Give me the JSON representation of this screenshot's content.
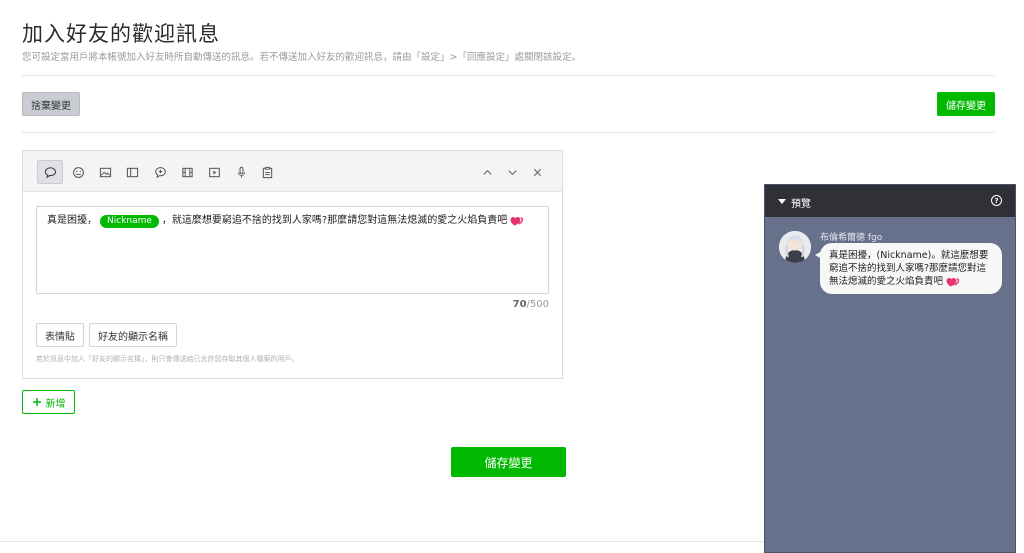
{
  "page": {
    "title": "加入好友的歡迎訊息",
    "description": "您可設定當用戶將本帳號加入好友時所自動傳送的訊息。若不傳送加入好友的歡迎訊息，請由「設定」>「回應設定」處關閉該設定。"
  },
  "actions": {
    "discard_label": "捨棄變更",
    "save_label": "儲存變更",
    "add_label": "新增",
    "save_main_label": "儲存變更"
  },
  "toolbar": {
    "tools": [
      "text-bubble-icon",
      "emoji-icon",
      "image-icon",
      "card-icon",
      "chat-reply-icon",
      "film-icon",
      "video-play-icon",
      "microphone-icon",
      "clipboard-icon"
    ],
    "controls": [
      "chevron-up-icon",
      "chevron-down-icon",
      "close-icon"
    ]
  },
  "editor": {
    "message_before": "真是困擾，",
    "nickname_chip": "Nickname",
    "message_after": "，就這麼想要窮追不捨的找到人家嗎?那麼請您對這無法熄滅的愛之火焰負責吧",
    "count_current": "70",
    "count_max": "/500",
    "sticker_button": "表情貼",
    "nickname_button": "好友的顯示名稱",
    "hint": "若於訊息中加入「好友的顯示名稱」，則只會傳送給已允許您存取其個人檔案的用戶。"
  },
  "preview": {
    "title": "預覽",
    "sender_name": "布倫希爾德 fgo",
    "bubble_text": "真是困擾，(Nickname)。就這麼想要窮追不捨的找到人家嗎?那麼請您對這無法熄滅的愛之火焰負責吧"
  },
  "colors": {
    "brand_green": "#00b900",
    "preview_bg": "#67718c",
    "preview_header": "#2f3137",
    "heart": "#e8336c"
  }
}
